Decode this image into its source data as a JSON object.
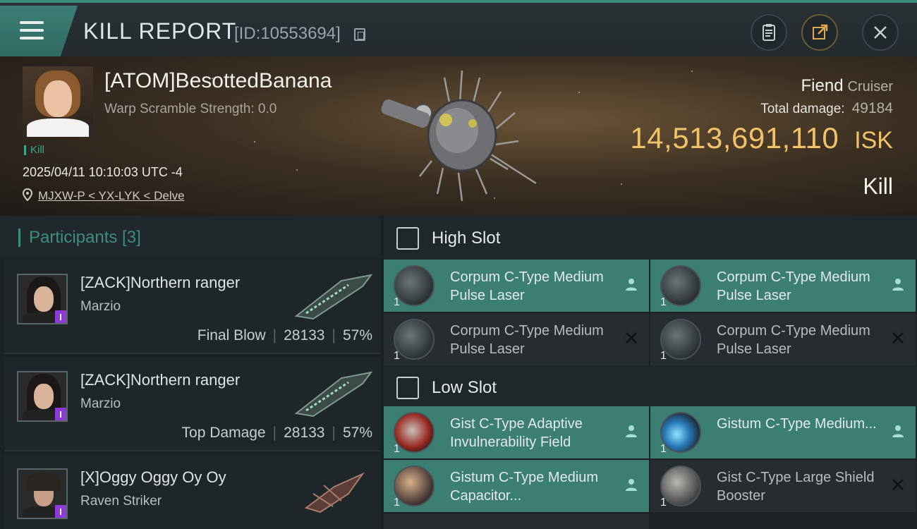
{
  "header": {
    "title": "KILL REPORT",
    "kill_id": "[ID:10553694]"
  },
  "victim": {
    "name": "[ATOM]BesottedBanana",
    "warp_scramble": "Warp Scramble Strength: 0.0",
    "tag": "Kill",
    "datetime": "2025/04/11 10:10:03 UTC -4",
    "location": "MJXW-P < YX-LYK < Delve"
  },
  "ship": {
    "name": "Fiend",
    "class": "Cruiser",
    "total_damage_label": "Total damage:",
    "total_damage": "49184",
    "isk_value": "14,513,691,110",
    "isk_unit": "ISK",
    "result": "Kill"
  },
  "participants": {
    "title": "Participants [3]",
    "list": [
      {
        "name": "[ZACK]Northern ranger",
        "ship": "Marzio",
        "role": "Final Blow",
        "damage": "28133",
        "percent": "57%"
      },
      {
        "name": "[ZACK]Northern ranger",
        "ship": "Marzio",
        "role": "Top Damage",
        "damage": "28133",
        "percent": "57%"
      },
      {
        "name": "[X]Oggy Oggy Oy Oy",
        "ship": "Raven Striker",
        "role": "",
        "damage": "",
        "percent": ""
      }
    ]
  },
  "fitting": {
    "high_slot": {
      "label": "High Slot",
      "modules": [
        {
          "name": "Corpum C-Type Medium Pulse Laser",
          "qty": "1",
          "status": "dropped"
        },
        {
          "name": "Corpum C-Type Medium Pulse Laser",
          "qty": "1",
          "status": "dropped"
        },
        {
          "name": "Corpum C-Type Medium Pulse Laser",
          "qty": "1",
          "status": "destroyed"
        },
        {
          "name": "Corpum C-Type Medium Pulse Laser",
          "qty": "1",
          "status": "destroyed"
        }
      ]
    },
    "low_slot": {
      "label": "Low Slot",
      "modules": [
        {
          "name": "Gist C-Type Adaptive Invulnerability Field",
          "qty": "1",
          "status": "dropped"
        },
        {
          "name": "Gistum C-Type Medium...",
          "qty": "1",
          "status": "dropped"
        },
        {
          "name": "Gistum C-Type Medium Capacitor...",
          "qty": "1",
          "status": "dropped"
        },
        {
          "name": "Gist C-Type Large Shield Booster",
          "qty": "1",
          "status": "destroyed"
        }
      ]
    }
  },
  "colors": {
    "accent": "#3c8c80",
    "isk": "#f0c36a",
    "corp_badge": "#8d3bd8"
  },
  "icons": [
    "menu-icon",
    "copy-icon",
    "clipboard-icon",
    "share-icon",
    "close-icon",
    "location-pin-icon",
    "user-icon",
    "x-icon"
  ]
}
